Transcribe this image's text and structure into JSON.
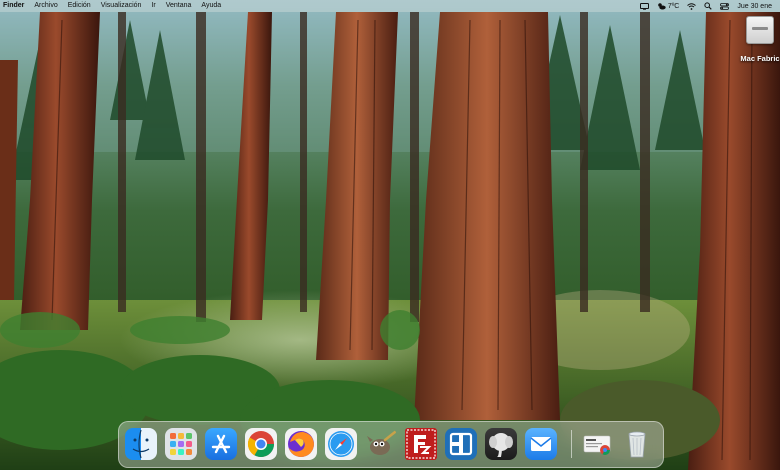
{
  "menubar": {
    "app_name": "Finder",
    "menus": [
      "Archivo",
      "Edición",
      "Visualización",
      "Ir",
      "Ventana",
      "Ayuda"
    ],
    "weather_temp": "7ºC",
    "clock": "Jue 30 ene",
    "status_icons": [
      "display-icon",
      "weather-icon",
      "wifi-icon",
      "search-icon",
      "control-center-icon"
    ]
  },
  "desktop": {
    "items": [
      {
        "label": "Mac Fabric",
        "icon": "hard-drive-icon"
      }
    ]
  },
  "dock": {
    "apps": [
      {
        "name": "Finder",
        "icon": "finder-icon"
      },
      {
        "name": "Launchpad",
        "icon": "launchpad-icon"
      },
      {
        "name": "App Store",
        "icon": "app-store-icon"
      },
      {
        "name": "Google Chrome",
        "icon": "chrome-icon"
      },
      {
        "name": "Firefox",
        "icon": "firefox-icon"
      },
      {
        "name": "Safari",
        "icon": "safari-icon"
      },
      {
        "name": "GIMP",
        "icon": "gimp-icon"
      },
      {
        "name": "FileZilla",
        "icon": "filezilla-icon"
      },
      {
        "name": "Remote Desktop",
        "icon": "remote-desktop-icon"
      },
      {
        "name": "Sequel Ace",
        "icon": "elephant-icon"
      },
      {
        "name": "Mail",
        "icon": "mail-icon"
      },
      {
        "name": "Downloads",
        "icon": "downloads-stack-icon"
      },
      {
        "name": "Trash",
        "icon": "trash-icon"
      }
    ]
  },
  "colors": {
    "menubar_bg": "#bfcdc8",
    "dock_bg": "#e1e6e1",
    "filezilla_red": "#bf1d1d",
    "remote_blue": "#1f6fb8",
    "appstore_blue": "#1a8cf0"
  }
}
